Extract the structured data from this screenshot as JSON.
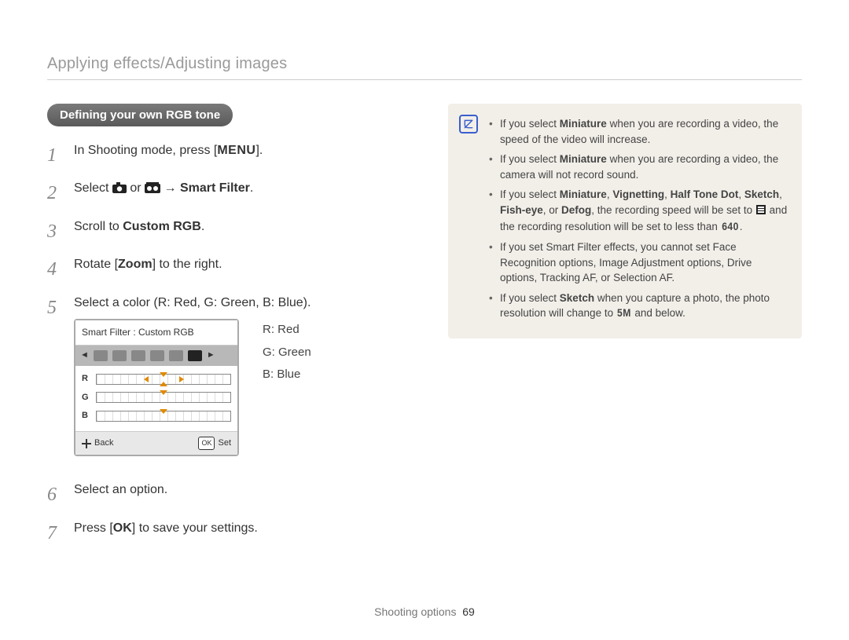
{
  "header": "Applying effects/Adjusting images",
  "pill": "Defining your own RGB tone",
  "steps": {
    "s1_a": "In Shooting mode, press [",
    "s1_menu": "MENU",
    "s1_b": "].",
    "s2_a": "Select ",
    "s2_b": " or ",
    "s2_arrow": " → ",
    "s2_bold": "Smart Filter",
    "s2_c": ".",
    "s3_a": "Scroll to ",
    "s3_bold": "Custom RGB",
    "s3_b": ".",
    "s4_a": "Rotate [",
    "s4_bold": "Zoom",
    "s4_b": "] to the right.",
    "s5": "Select a color (R: Red, G: Green, B: Blue).",
    "s6": "Select an option.",
    "s7_a": "Press [",
    "s7_ok": "OK",
    "s7_b": "] to save your settings."
  },
  "cam": {
    "title": "Smart Filter : Custom RGB",
    "r": "R",
    "g": "G",
    "b": "B",
    "back": "Back",
    "ok": "OK",
    "set": "Set"
  },
  "legend": {
    "r": "R: Red",
    "g": "G: Green",
    "b": "B: Blue"
  },
  "notes": {
    "n1_a": "If you select ",
    "n1_bold": "Miniature",
    "n1_b": " when you are recording a video, the speed of the video will increase.",
    "n2_a": "If you select ",
    "n2_bold": "Miniature",
    "n2_b": " when you are recording a video, the camera will not record sound.",
    "n3_a": "If you select ",
    "n3_b1": "Miniature",
    "n3_c": ", ",
    "n3_b2": "Vignetting",
    "n3_d": ", ",
    "n3_b3": "Half Tone Dot",
    "n3_e": ", ",
    "n3_b4": "Sketch",
    "n3_f": ", ",
    "n3_b5": "Fish-eye",
    "n3_g": ", or ",
    "n3_b6": "Defog",
    "n3_h": ", the recording speed will be set to ",
    "n3_i": " and the recording resolution will be set to less than ",
    "n3_res": "640",
    "n3_j": ".",
    "n4": "If you set Smart Filter effects, you cannot set Face Recognition options, Image Adjustment options, Drive options, Tracking AF, or Selection AF.",
    "n5_a": "If you select ",
    "n5_bold": "Sketch",
    "n5_b": " when you capture a photo, the photo resolution will change to ",
    "n5_res": "5M",
    "n5_c": " and below."
  },
  "footer": {
    "section": "Shooting options",
    "page": "69"
  }
}
